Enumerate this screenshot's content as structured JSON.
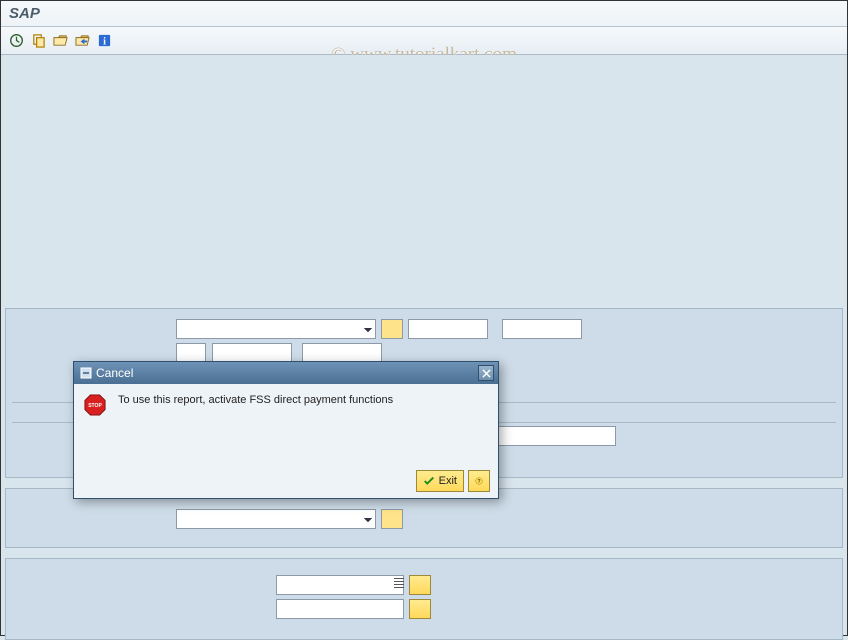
{
  "window": {
    "title": "SAP"
  },
  "watermark": "© www.tutorialkart.com",
  "toolbar": {
    "icons": [
      "clock-icon",
      "copy-icon",
      "open-folder-icon",
      "folder-arrow-icon",
      "info-icon"
    ]
  },
  "panel1": {
    "select_value": "",
    "req_value": "",
    "text1": "",
    "text2": "",
    "small": "",
    "med1": "",
    "med2": "",
    "bottom_text": ""
  },
  "panel2": {
    "select_value": "",
    "req_value": ""
  },
  "panel3": {
    "text1": "",
    "text2": ""
  },
  "dialog": {
    "title": "Cancel",
    "message": "To use this report, activate FSS direct payment functions",
    "exit_label": "Exit"
  }
}
